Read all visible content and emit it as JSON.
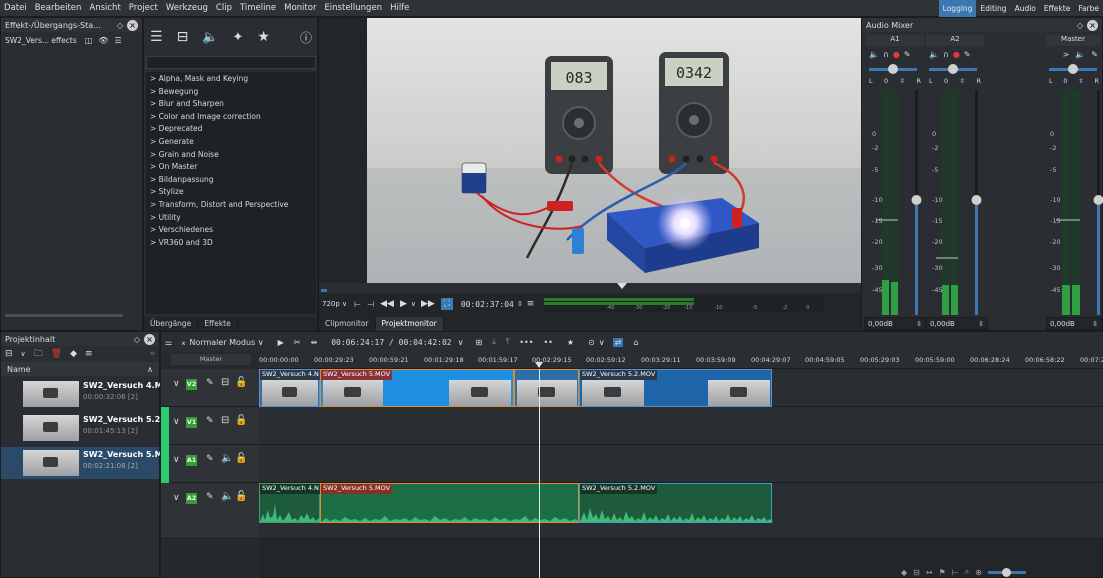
{
  "menu": [
    "Datei",
    "Bearbeiten",
    "Ansicht",
    "Project",
    "Werkzeug",
    "Clip",
    "Timeline",
    "Monitor",
    "Einstellungen",
    "Hilfe"
  ],
  "layouts": [
    {
      "label": "Logging",
      "active": true
    },
    {
      "label": "Editing",
      "active": false
    },
    {
      "label": "Audio",
      "active": false
    },
    {
      "label": "Effekte",
      "active": false
    },
    {
      "label": "Farbe",
      "active": false
    }
  ],
  "effect_stack": {
    "title": "Effekt-/Übergangs-Sta...",
    "clip_label": "SW2_Vers... effects"
  },
  "effects": {
    "categories": [
      "Alpha, Mask and Keying",
      "Bewegung",
      "Blur and Sharpen",
      "Color and Image correction",
      "Deprecated",
      "Generate",
      "Grain and Noise",
      "On Master",
      "Bildanpassung",
      "Stylize",
      "Transform, Distort and Perspective",
      "Utility",
      "Verschiedenes",
      "VR360 and 3D"
    ],
    "tabs": [
      "Übergänge",
      "Effekte"
    ]
  },
  "monitor": {
    "resolution": "720p",
    "timecode": "00:02:37:04",
    "tabs": [
      "Clipmonitor",
      "Projektmonitor"
    ],
    "meter_labels": [
      "-40",
      "-30",
      "-20",
      "-15",
      "-10",
      "-5",
      "-2",
      "0"
    ],
    "display_left": "083",
    "display_right": "0342"
  },
  "audio_mixer": {
    "title": "Audio Mixer",
    "channels": [
      {
        "name": "A1",
        "level": "0,00dB"
      },
      {
        "name": "A2",
        "level": "0,00dB"
      },
      {
        "name": "Master",
        "level": "0,00dB"
      }
    ],
    "scale": [
      "0",
      "-2",
      "-5",
      "-10",
      "-15",
      "-20",
      "-30",
      "-45"
    ],
    "lr_left": "L",
    "lr_value": "0",
    "lr_right": "R"
  },
  "project": {
    "title": "Projektinhalt",
    "column_name": "Name",
    "items": [
      {
        "name": "SW2_Versuch 4.MC",
        "duration": "00:00:32:06 [2]"
      },
      {
        "name": "SW2_Versuch 5.2.M",
        "duration": "00:01:45:13 [2]"
      },
      {
        "name": "SW2_Versuch 5.MC",
        "duration": "00:02:21:08 [2]"
      }
    ]
  },
  "timeline": {
    "mode": "Normaler Modus",
    "timecode": "00:06:24:17 / 00:04:42:02",
    "master_label": "Master",
    "ruler": [
      "00:00:00:00",
      "00:00:29:23",
      "00:00:59:21",
      "00:01:29:18",
      "00:01:59:17",
      "00:02:29:15",
      "00:02:59:12",
      "00:03:29:11",
      "00:03:59:09",
      "00:04:29:07",
      "00:04:59:05",
      "00:05:29:03",
      "00:05:59:00",
      "00:06:28:24",
      "00:06:58:22",
      "00:07:2"
    ],
    "tracks": [
      "V2",
      "V1",
      "A1",
      "A2"
    ],
    "clips": {
      "v2_a": "SW2_Versuch 4.N",
      "v2_b": "SW2_Versuch 5.MOV",
      "v2_c": "SW2_Versuch 5.2.MOV",
      "a2_a": "SW2_Versuch 4.N",
      "a2_b": "SW2_Versuch 5.MOV",
      "a2_c": "SW2_Versuch 5.2.MOV"
    }
  }
}
